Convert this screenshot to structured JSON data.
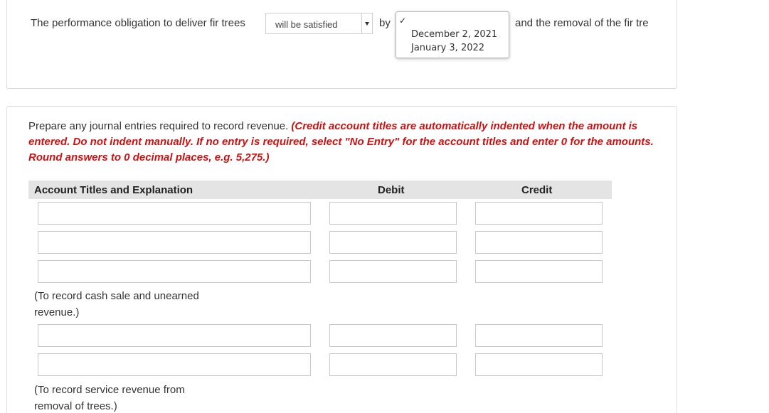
{
  "question": {
    "sentence_prefix": "The performance obligation to deliver fir trees",
    "satisfied_select": {
      "value": "will be satisfied"
    },
    "by_label": "by",
    "date_select": {
      "check_mark": "✓",
      "options": [
        "December 2, 2021",
        "January 3, 2022"
      ]
    },
    "sentence_suffix": "and the removal of the fir tre"
  },
  "instructions": {
    "normal": "Prepare any journal entries required to record revenue. ",
    "emphasis": "(Credit account titles are automatically indented when the amount is entered. Do not indent manually. If no entry is required, select \"No Entry\" for the account titles and enter 0 for the amounts. Round answers to 0 decimal places, e.g. 5,275.)"
  },
  "table": {
    "headers": {
      "account": "Account Titles and Explanation",
      "debit": "Debit",
      "credit": "Credit"
    },
    "entries": [
      {
        "memo": "(To record cash sale and unearned revenue.)",
        "rows": [
          {
            "account": "",
            "debit": "",
            "credit": ""
          },
          {
            "account": "",
            "debit": "",
            "credit": ""
          },
          {
            "account": "",
            "debit": "",
            "credit": ""
          }
        ]
      },
      {
        "memo": "(To record service revenue from removal of trees.)",
        "rows": [
          {
            "account": "",
            "debit": "",
            "credit": ""
          },
          {
            "account": "",
            "debit": "",
            "credit": ""
          }
        ]
      }
    ]
  }
}
